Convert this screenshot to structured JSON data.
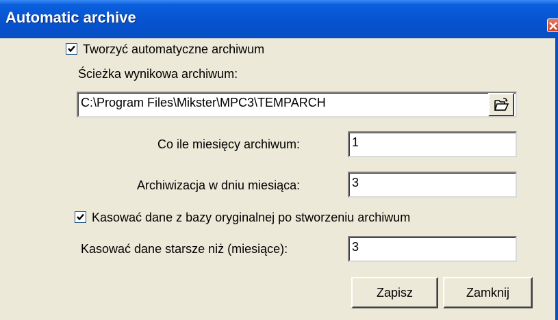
{
  "window": {
    "title": "Automatic archive"
  },
  "options": {
    "auto_archive_label": "Tworzyć automatyczne archiwum",
    "auto_archive_checked": true,
    "path_label": "Ścieżka wynikowa archiwum:",
    "path_value": "C:\\Program Files\\Mikster\\MPC3\\TEMPARCH",
    "months_label": "Co ile miesięcy archiwum:",
    "months_value": "1",
    "day_label": "Archiwizacja w dniu miesiąca:",
    "day_value": "3",
    "delete_label": "Kasować dane z bazy oryginalnej po stworzeniu archiwum",
    "delete_checked": true,
    "older_label": "Kasować dane starsze niż (miesiące):",
    "older_value": "3"
  },
  "buttons": {
    "save_label": "Zapisz",
    "close_label": "Zamknij"
  },
  "icons": {
    "close": "close-icon",
    "browse": "folder-open-icon",
    "check": "checkmark-icon"
  }
}
